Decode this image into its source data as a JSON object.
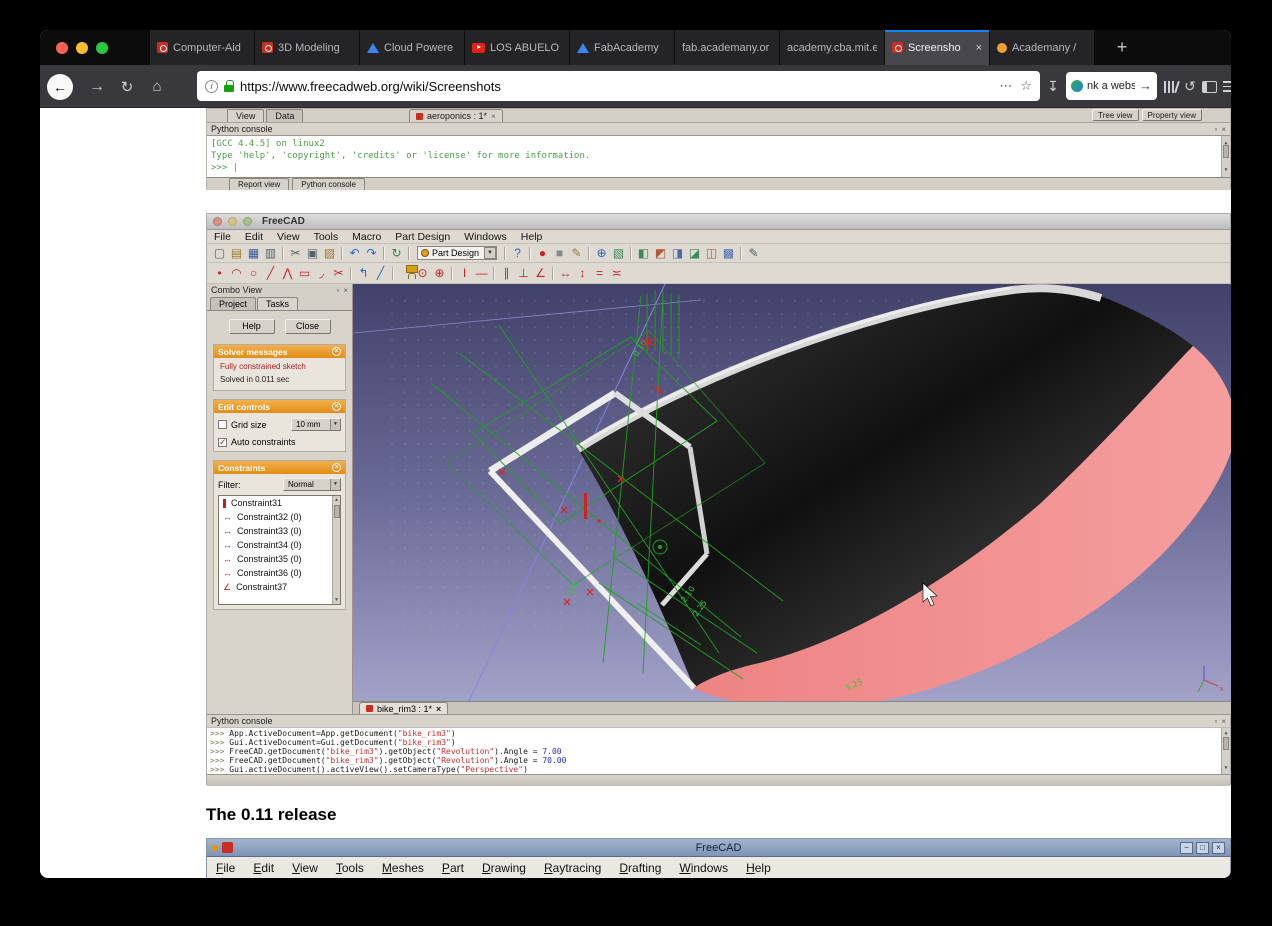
{
  "browser": {
    "new_tab_label": "+",
    "tabs": [
      {
        "label": "Computer-Aid",
        "icon": "freecad-icon",
        "active": false
      },
      {
        "label": "3D Modeling",
        "icon": "freecad-icon",
        "active": false
      },
      {
        "label": "Cloud Powere",
        "icon": "drive-icon",
        "active": false
      },
      {
        "label": "LOS ABUELO",
        "icon": "youtube-icon",
        "active": false
      },
      {
        "label": "FabAcademy",
        "icon": "drive-icon",
        "active": false
      },
      {
        "label": "fab.academany.or",
        "icon": "",
        "active": false
      },
      {
        "label": "academy.cba.mit.e",
        "icon": "",
        "active": false
      },
      {
        "label": "Screensho",
        "icon": "freecad-icon",
        "active": true,
        "close_glyph": "×"
      },
      {
        "label": "Academany /",
        "icon": "academany-icon",
        "active": false
      }
    ],
    "nav": {
      "url": "https://www.freecadweb.org/wiki/Screenshots",
      "search_text": "nk a website that is insic"
    }
  },
  "page": {
    "heading": "The 0.11 release"
  },
  "top_screenshot": {
    "pane_tabs": [
      "View",
      "Data"
    ],
    "doc_tab": "aeroponics : 1*",
    "right_buttons": [
      "Tree view",
      "Property view"
    ],
    "console_title": "Python console",
    "console_lines": [
      "[GCC 4.4.5] on linux2",
      "Type 'help', 'copyright', 'credits' or 'license' for more information.",
      ">>> |"
    ],
    "bottom_tabs": [
      "Report view",
      "Python console"
    ]
  },
  "freecad": {
    "title": "FreeCAD",
    "menu_items": [
      "File",
      "Edit",
      "View",
      "Tools",
      "Macro",
      "Part Design",
      "Windows",
      "Help"
    ],
    "workbench": "Part Design",
    "toolbar_main": [
      "new-document",
      "open-document",
      "save-document",
      "print",
      "|",
      "cut",
      "copy",
      "paste",
      "|",
      "undo",
      "redo",
      "|",
      "refresh",
      "|",
      "WORKBENCH",
      "|",
      "whats-this",
      "|",
      "record-macro",
      "stop-macro",
      "edit-macro",
      "|",
      "fit-all",
      "axonometric-view",
      "|",
      "front-view",
      "top-view",
      "right-view",
      "rear-view",
      "bottom-view",
      "left-view",
      "|",
      "draw-style"
    ],
    "toolbar_sketch": [
      "create-point",
      "create-arc",
      "create-circle",
      "create-line",
      "create-polyline",
      "create-rectangle",
      "create-fillet",
      "trim-edge",
      "|",
      "external-geometry",
      "toggle-construction",
      "|",
      "constraint-lock",
      "constraint-coincident",
      "constraint-point-on-object",
      "|",
      "constraint-vertical",
      "constraint-horizontal",
      "|",
      "constraint-parallel",
      "constraint-perpendicular",
      "constraint-angle",
      "|",
      "constraint-horizontal-distance",
      "constraint-vertical-distance",
      "constraint-equal",
      "constraint-symmetric"
    ],
    "combo_view": {
      "title": "Combo View",
      "tabs": [
        "Project",
        "Tasks"
      ],
      "help_button": "Help",
      "close_button": "Close",
      "solver": {
        "title": "Solver messages",
        "message": "Fully constrained sketch",
        "detail": "Solved in 0.011 sec"
      },
      "edit_controls": {
        "title": "Edit controls",
        "grid_label": "Grid size",
        "grid_value": "10 mm",
        "auto_constraints_label": "Auto constraints"
      },
      "constraints": {
        "title": "Constraints",
        "filter_label": "Filter:",
        "filter_value": "Normal",
        "items": [
          {
            "label": "Constraint31",
            "icon": "vertical-constraint-icon"
          },
          {
            "label": "Constraint32 (0)",
            "icon": "distance-constraint-icon"
          },
          {
            "label": "Constraint33 (0)",
            "icon": "distance-constraint-icon"
          },
          {
            "label": "Constraint34 (0)",
            "icon": "distance-constraint-icon"
          },
          {
            "label": "Constraint35 (0)",
            "icon": "distance-constraint-icon"
          },
          {
            "label": "Constraint36 (0)",
            "icon": "distance-constraint-icon"
          },
          {
            "label": "Constraint37",
            "icon": "angle-constraint-icon"
          }
        ]
      }
    },
    "viewport": {
      "doc_tab": "bike_rim3 : 1*",
      "sketch_labels": [
        "0.10",
        "0.6",
        "2.10",
        "2.25",
        "5.25"
      ],
      "axis_label": "x"
    },
    "python_console": {
      "title": "Python console",
      "lines": [
        [
          {
            "t": ">>> ",
            "c": "p"
          },
          {
            "t": "App.ActiveDocument=App.getDocument(",
            "c": "k"
          },
          {
            "t": "\"bike_rim3\"",
            "c": "s"
          },
          {
            "t": ")",
            "c": "k"
          }
        ],
        [
          {
            "t": ">>> ",
            "c": "p"
          },
          {
            "t": "Gui.ActiveDocument=Gui.getDocument(",
            "c": "k"
          },
          {
            "t": "\"bike_rim3\"",
            "c": "s"
          },
          {
            "t": ")",
            "c": "k"
          }
        ],
        [
          {
            "t": ">>> ",
            "c": "p"
          },
          {
            "t": "FreeCAD.getDocument(",
            "c": "k"
          },
          {
            "t": "\"bike_rim3\"",
            "c": "s"
          },
          {
            "t": ").getObject(",
            "c": "k"
          },
          {
            "t": "\"Revolution\"",
            "c": "s"
          },
          {
            "t": ").Angle = ",
            "c": "k"
          },
          {
            "t": "7.00",
            "c": "n"
          }
        ],
        [
          {
            "t": ">>> ",
            "c": "p"
          },
          {
            "t": "FreeCAD.getDocument(",
            "c": "k"
          },
          {
            "t": "\"bike_rim3\"",
            "c": "s"
          },
          {
            "t": ").getObject(",
            "c": "k"
          },
          {
            "t": "\"Revolution\"",
            "c": "s"
          },
          {
            "t": ").Angle = ",
            "c": "k"
          },
          {
            "t": "70.00",
            "c": "n"
          }
        ],
        [
          {
            "t": ">>> ",
            "c": "p"
          },
          {
            "t": "Gui.activeDocument().activeView().setCameraType(",
            "c": "k"
          },
          {
            "t": "\"Perspective\"",
            "c": "s"
          },
          {
            "t": ")",
            "c": "k"
          }
        ]
      ]
    }
  },
  "release_screenshot": {
    "title": "FreeCAD",
    "window_buttons": [
      "−",
      "□",
      "×"
    ],
    "menu_items": [
      "File",
      "Edit",
      "View",
      "Tools",
      "Meshes",
      "Part",
      "Drawing",
      "Raytracing",
      "Drafting",
      "Windows",
      "Help"
    ]
  }
}
